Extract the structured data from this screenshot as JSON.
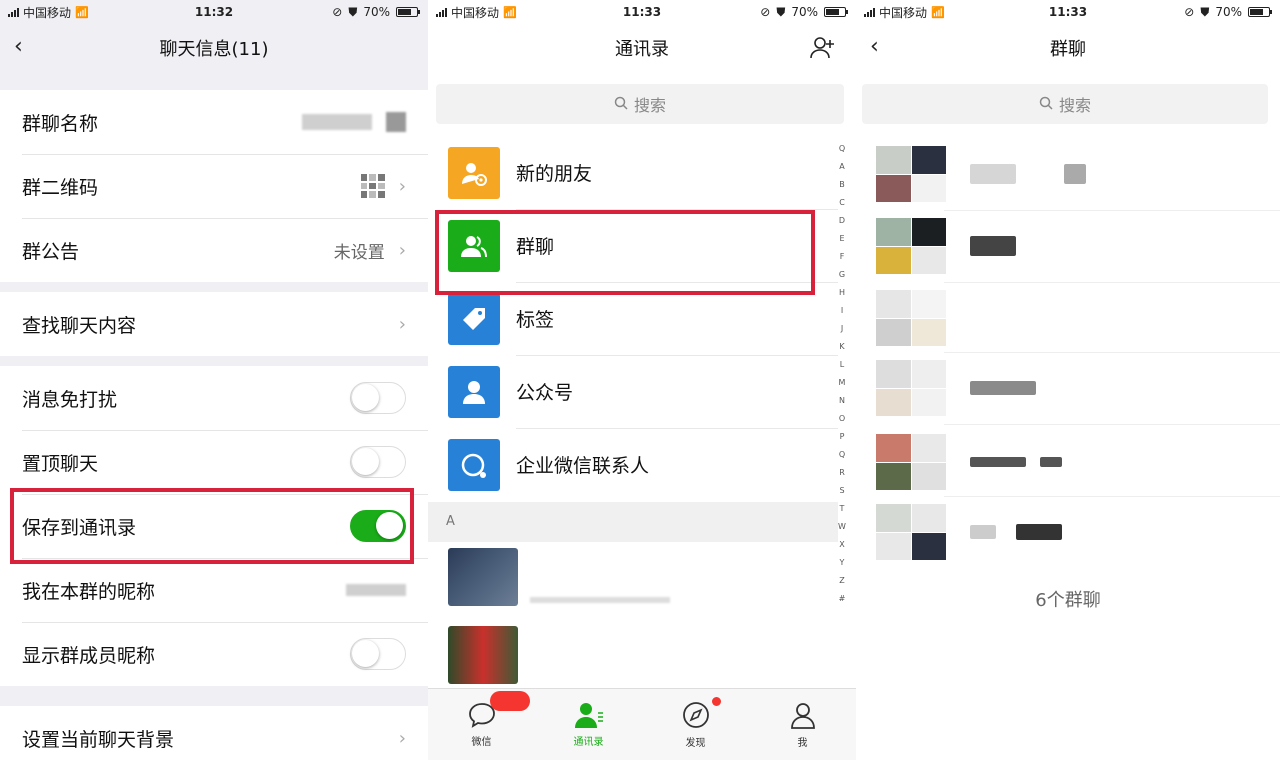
{
  "status_bars": [
    {
      "carrier": "中国移动",
      "time": "11:32",
      "battery": "70%",
      "battery_level": 0.7
    },
    {
      "carrier": "中国移动",
      "time": "11:33",
      "battery": "70%",
      "battery_level": 0.7
    },
    {
      "carrier": "中国移动",
      "time": "11:33",
      "battery": "70%",
      "battery_level": 0.7
    }
  ],
  "chat_info": {
    "title": "聊天信息(11)",
    "rows": {
      "group_name": "群聊名称",
      "group_qr": "群二维码",
      "announcement": "群公告",
      "announcement_value": "未设置",
      "search_content": "查找聊天内容",
      "mute": "消息免打扰",
      "sticky": "置顶聊天",
      "save_to_contacts": "保存到通讯录",
      "my_alias": "我在本群的昵称",
      "show_alias": "显示群成员昵称",
      "background": "设置当前聊天背景"
    },
    "toggles": {
      "mute": false,
      "sticky": false,
      "save_to_contacts": true,
      "show_alias": false
    }
  },
  "contacts": {
    "title": "通讯录",
    "search_placeholder": "搜索",
    "entries": [
      "新的朋友",
      "群聊",
      "标签",
      "公众号",
      "企业微信联系人"
    ],
    "section_letter": "A",
    "index_letters": [
      "Q",
      "A",
      "B",
      "C",
      "D",
      "E",
      "F",
      "G",
      "H",
      "I",
      "J",
      "K",
      "L",
      "M",
      "N",
      "O",
      "P",
      "Q",
      "R",
      "S",
      "T",
      "W",
      "X",
      "Y",
      "Z",
      "#"
    ],
    "tabs": [
      "微信",
      "通讯录",
      "发现",
      "我"
    ],
    "active_tab": "通讯录"
  },
  "groups": {
    "title": "群聊",
    "search_placeholder": "搜索",
    "count_label": "6个群聊"
  },
  "colors": {
    "accent": "#1aad19",
    "highlight": "#d8213a",
    "new_friend": "#f5a623",
    "group_chat": "#1aad19",
    "tags": "#2782d7",
    "official": "#2782d7",
    "work": "#2782d7"
  }
}
